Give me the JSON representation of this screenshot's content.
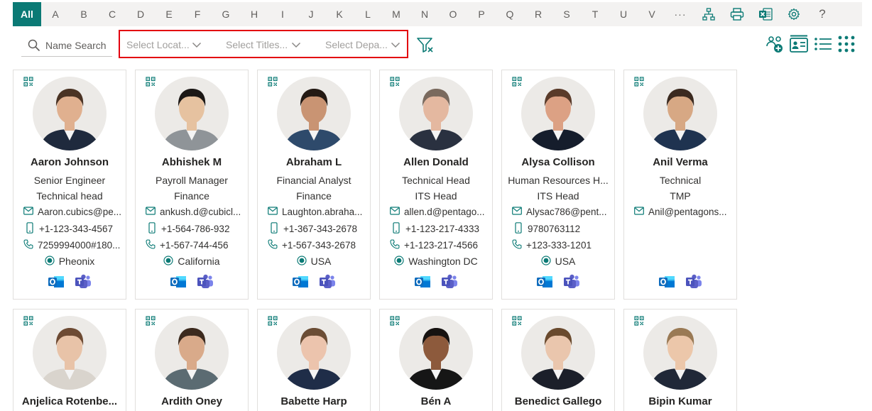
{
  "alphabet": [
    "All",
    "A",
    "B",
    "C",
    "D",
    "E",
    "F",
    "G",
    "H",
    "I",
    "J",
    "K",
    "L",
    "M",
    "N",
    "O",
    "P",
    "Q",
    "R",
    "S",
    "T",
    "U",
    "V"
  ],
  "alphabet_active": "All",
  "toolbar_icons": [
    "more-icon",
    "org-chart-icon",
    "print-icon",
    "excel-export-icon",
    "settings-icon",
    "help-icon"
  ],
  "toolbar": {
    "more": "···",
    "help": "?"
  },
  "search": {
    "placeholder": "Name Search"
  },
  "filters": [
    {
      "label": "Select Locat..."
    },
    {
      "label": "Select Titles..."
    },
    {
      "label": "Select Depa..."
    }
  ],
  "views": [
    "add-contact-view-icon",
    "card-view-icon",
    "list-view-icon",
    "grid-view-icon"
  ],
  "colors": {
    "accent": "#0b7a75",
    "highlight": "#e3000f",
    "outlook": "#0f6cbd",
    "teams": "#5b5fc7"
  },
  "employees": [
    {
      "name": "Aaron Johnson",
      "title": "Senior Engineer",
      "department": "Technical head",
      "email": "Aaron.cubics@pe...",
      "phone": "+1-123-343-4567",
      "work": "7259994000#180...",
      "location": "Pheonix",
      "skin": "#e0b08f",
      "hair": "#4a3324",
      "shirt": "#1f2a3d"
    },
    {
      "name": "Abhishek M",
      "title": "Payroll Manager",
      "department": "Finance",
      "email": "ankush.d@cubicl...",
      "phone": "+1-564-786-932",
      "work": "+1-567-744-456",
      "location": "California",
      "skin": "#e6c2a0",
      "hair": "#1c1816",
      "shirt": "#8f9498"
    },
    {
      "name": "Abraham L",
      "title": "Financial Analyst",
      "department": "Finance",
      "email": "Laughton.abraha...",
      "phone": "+1-367-343-2678",
      "work": "+1-567-343-2678",
      "location": "USA",
      "skin": "#c99473",
      "hair": "#241a14",
      "shirt": "#2e4a6b"
    },
    {
      "name": "Allen Donald",
      "title": "Technical Head",
      "department": "ITS Head",
      "email": "allen.d@pentago...",
      "phone": "+1-123-217-4333",
      "work": "+1-123-217-4566",
      "location": "Washington DC",
      "skin": "#e4b8a0",
      "hair": "#7a6a5e",
      "shirt": "#2a3140"
    },
    {
      "name": "Alysa Collison",
      "title": "Human Resources H...",
      "department": "ITS Head",
      "email": "Alysac786@pent...",
      "phone": "9780763112",
      "work": "+123-333-1201",
      "location": "USA",
      "skin": "#dca184",
      "hair": "#5a3b2a",
      "shirt": "#151d2c"
    },
    {
      "name": "Anil Verma",
      "title": "Technical",
      "department": "TMP",
      "email": "Anil@pentagons...",
      "phone": "",
      "work": "",
      "location": "",
      "skin": "#d7a884",
      "hair": "#3b2a20",
      "shirt": "#1f3350"
    },
    {
      "name": "Anjelica Rotenbe...",
      "skin": "#e8c3a8",
      "hair": "#6d4a33",
      "shirt": "#d9d4cd"
    },
    {
      "name": "Ardith Oney",
      "skin": "#d9aa8a",
      "hair": "#3c2a1e",
      "shirt": "#5b6b72"
    },
    {
      "name": "Babette Harp",
      "skin": "#ecc4ad",
      "hair": "#6b4d35",
      "shirt": "#1f2d48"
    },
    {
      "name": "Bén A",
      "skin": "#8d5a3c",
      "hair": "#161210",
      "shirt": "#161616"
    },
    {
      "name": "Benedict Gallego",
      "skin": "#eac6ad",
      "hair": "#6a4a2e",
      "shirt": "#1b1f2a"
    },
    {
      "name": "Bipin Kumar",
      "skin": "#ecc7aa",
      "hair": "#9a7a55",
      "shirt": "#202838"
    }
  ]
}
